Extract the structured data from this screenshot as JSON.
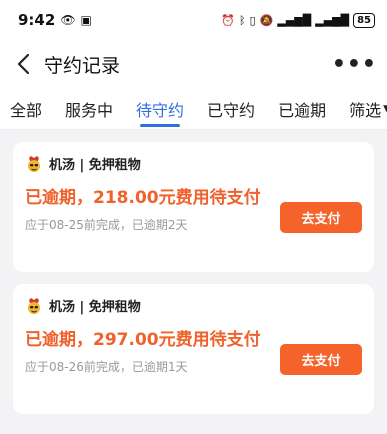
{
  "status_bar": {
    "time": "9:42",
    "battery": "85"
  },
  "header": {
    "title": "守约记录"
  },
  "tabs": [
    {
      "label": "全部"
    },
    {
      "label": "服务中"
    },
    {
      "label": "待守约",
      "active": true
    },
    {
      "label": "已守约"
    },
    {
      "label": "已逾期"
    },
    {
      "label": "筛选"
    }
  ],
  "records": [
    {
      "merchant": "机汤 | 免押租物",
      "status": "已逾期，218.00元费用待支付",
      "detail": "应于08-25前完成，已逾期2天",
      "action": "去支付"
    },
    {
      "merchant": "机汤 | 免押租物",
      "status": "已逾期，297.00元费用待支付",
      "detail": "应于08-26前完成，已逾期1天",
      "action": "去支付"
    }
  ],
  "colors": {
    "accent": "#2f6fdf",
    "overdue": "#f0612c",
    "button": "#f5622a"
  }
}
